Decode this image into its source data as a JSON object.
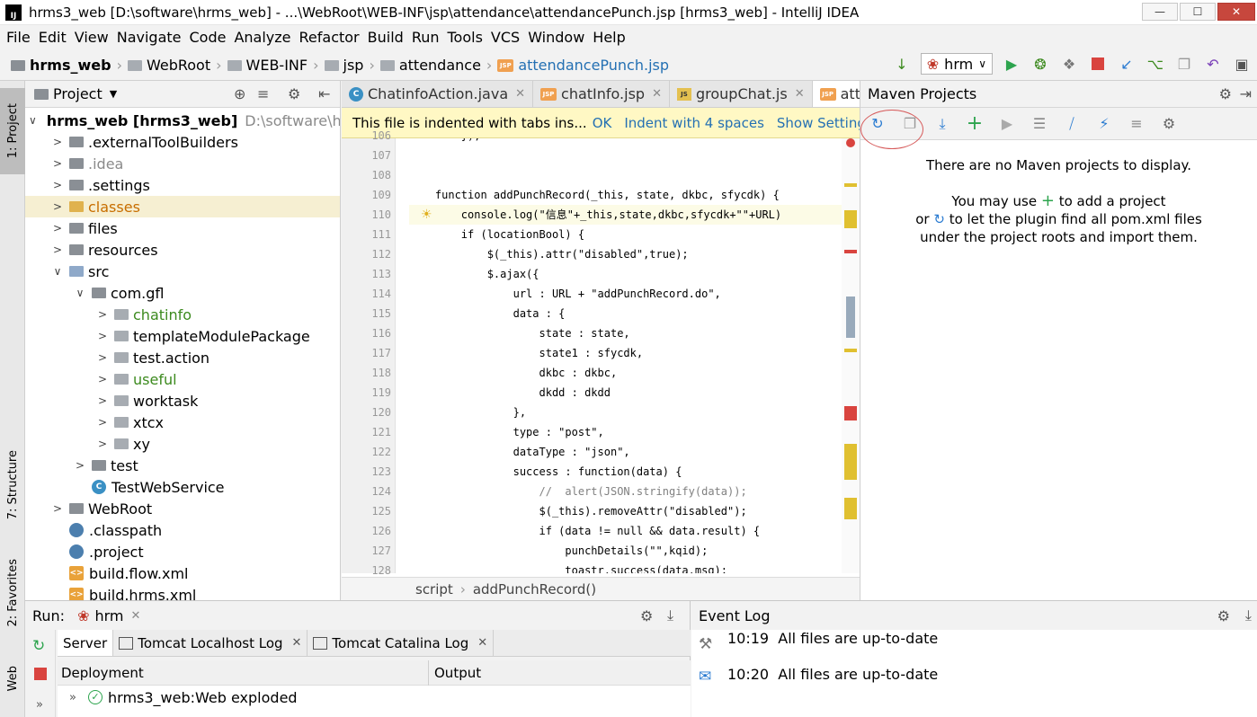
{
  "window": {
    "title": "hrms3_web [D:\\software\\hrms_web] - ...\\WebRoot\\WEB-INF\\jsp\\attendance\\attendancePunch.jsp [hrms3_web] - IntelliJ IDEA",
    "minimize": "—",
    "maximize": "☐",
    "close": "✕"
  },
  "menu": [
    "File",
    "Edit",
    "View",
    "Navigate",
    "Code",
    "Analyze",
    "Refactor",
    "Build",
    "Run",
    "Tools",
    "VCS",
    "Window",
    "Help"
  ],
  "breadcrumb": [
    "hrms_web",
    "WebRoot",
    "WEB-INF",
    "jsp",
    "attendance",
    "attendancePunch.jsp"
  ],
  "run_config": "hrm",
  "side_tabs": {
    "project": "1: Project",
    "structure": "7: Structure",
    "favorites": "2: Favorites",
    "web": "Web"
  },
  "project": {
    "header": "Project",
    "tree": [
      {
        "label": "hrms_web [hrms3_web]",
        "extra": "D:\\software\\hrm",
        "depth": 0,
        "arrow": "∨",
        "kind": "module"
      },
      {
        "label": ".externalToolBuilders",
        "depth": 1,
        "arrow": ">",
        "kind": "folder"
      },
      {
        "label": ".idea",
        "depth": 1,
        "arrow": ">",
        "kind": "folder",
        "color": "gray"
      },
      {
        "label": ".settings",
        "depth": 1,
        "arrow": ">",
        "kind": "folder"
      },
      {
        "label": "classes",
        "depth": 1,
        "arrow": ">",
        "kind": "folder-yellow",
        "color": "orange",
        "selected": true
      },
      {
        "label": "files",
        "depth": 1,
        "arrow": ">",
        "kind": "folder"
      },
      {
        "label": "resources",
        "depth": 1,
        "arrow": ">",
        "kind": "folder"
      },
      {
        "label": "src",
        "depth": 1,
        "arrow": "∨",
        "kind": "folder-blue"
      },
      {
        "label": "com.gfl",
        "depth": 2,
        "arrow": "∨",
        "kind": "folder"
      },
      {
        "label": "chatinfo",
        "depth": 3,
        "arrow": ">",
        "kind": "package",
        "color": "green"
      },
      {
        "label": "templateModulePackage",
        "depth": 3,
        "arrow": ">",
        "kind": "package"
      },
      {
        "label": "test.action",
        "depth": 3,
        "arrow": ">",
        "kind": "package"
      },
      {
        "label": "useful",
        "depth": 3,
        "arrow": ">",
        "kind": "package",
        "color": "green"
      },
      {
        "label": "worktask",
        "depth": 3,
        "arrow": ">",
        "kind": "package"
      },
      {
        "label": "xtcx",
        "depth": 3,
        "arrow": ">",
        "kind": "package"
      },
      {
        "label": "xy",
        "depth": 3,
        "arrow": ">",
        "kind": "package"
      },
      {
        "label": "test",
        "depth": 2,
        "arrow": ">",
        "kind": "folder"
      },
      {
        "label": "TestWebService",
        "depth": 2,
        "arrow": "",
        "kind": "class"
      },
      {
        "label": "WebRoot",
        "depth": 1,
        "arrow": ">",
        "kind": "folder"
      },
      {
        "label": ".classpath",
        "depth": 1,
        "arrow": "",
        "kind": "file"
      },
      {
        "label": ".project",
        "depth": 1,
        "arrow": "",
        "kind": "file"
      },
      {
        "label": "build.flow.xml",
        "depth": 1,
        "arrow": "",
        "kind": "xml"
      },
      {
        "label": "build.hrms.xml",
        "depth": 1,
        "arrow": "",
        "kind": "xml"
      }
    ]
  },
  "editor": {
    "tabs": [
      {
        "label": "ChatinfoAction.java",
        "kind": "class"
      },
      {
        "label": "chatInfo.jsp",
        "kind": "jsp"
      },
      {
        "label": "groupChat.js",
        "kind": "js"
      },
      {
        "label": "attendan",
        "kind": "jsp",
        "active": true
      }
    ],
    "banner": {
      "message": "This file is indented with tabs ins...",
      "ok": "OK",
      "indent": "Indent with 4 spaces",
      "settings": "Show Settings"
    },
    "lines": [
      {
        "n": "106",
        "text": "        });"
      },
      {
        "n": "107",
        "text": ""
      },
      {
        "n": "108",
        "text": ""
      },
      {
        "n": "109",
        "text": "    function addPunchRecord(_this, state, dkbc, sfycdk) {"
      },
      {
        "n": "110",
        "text": "        console.log(\"信息\"+_this,state,dkbc,sfycdk+\"\"+URL)"
      },
      {
        "n": "111",
        "text": "        if (locationBool) {"
      },
      {
        "n": "112",
        "text": "            $(_this).attr(\"disabled\",true);"
      },
      {
        "n": "113",
        "text": "            $.ajax({"
      },
      {
        "n": "114",
        "text": "                url : URL + \"addPunchRecord.do\","
      },
      {
        "n": "115",
        "text": "                data : {"
      },
      {
        "n": "116",
        "text": "                    state : state,"
      },
      {
        "n": "117",
        "text": "                    state1 : sfycdk,"
      },
      {
        "n": "118",
        "text": "                    dkbc : dkbc,"
      },
      {
        "n": "119",
        "text": "                    dkdd : dkdd"
      },
      {
        "n": "120",
        "text": "                },"
      },
      {
        "n": "121",
        "text": "                type : \"post\","
      },
      {
        "n": "122",
        "text": "                dataType : \"json\","
      },
      {
        "n": "123",
        "text": "                success : function(data) {"
      },
      {
        "n": "124",
        "text": "                    //  alert(JSON.stringify(data));"
      },
      {
        "n": "125",
        "text": "                    $(_this).removeAttr(\"disabled\");"
      },
      {
        "n": "126",
        "text": "                    if (data != null && data.result) {"
      },
      {
        "n": "127",
        "text": "                        punchDetails(\"\",kqid);"
      },
      {
        "n": "128",
        "text": "                        toastr.success(data.msg);"
      }
    ],
    "crumbs": [
      "script",
      "addPunchRecord()"
    ]
  },
  "maven": {
    "header": "Maven Projects",
    "empty": "There are no Maven projects to display.",
    "hint1": "You may use",
    "hint1b": "to add a project",
    "hint2": "or",
    "hint2b": "to let the plugin find all pom.xml files",
    "hint3": "under the project roots and import them."
  },
  "run": {
    "label": "Run:",
    "config": "hrm",
    "tabs": [
      "Server",
      "Tomcat Localhost Log",
      "Tomcat Catalina Log"
    ],
    "col_deployment": "Deployment",
    "col_output": "Output",
    "artifact": "hrms3_web:Web exploded"
  },
  "event_log": {
    "title": "Event Log",
    "entries": [
      {
        "time": "10:19",
        "msg": "All files are up-to-date"
      },
      {
        "time": "10:20",
        "msg": "All files are up-to-date"
      }
    ]
  },
  "colors": {
    "accent": "#2470b3",
    "banner": "#fff8c4",
    "selection": "#f6efd2",
    "run_green": "#2da44e",
    "stop_red": "#d9443f"
  }
}
